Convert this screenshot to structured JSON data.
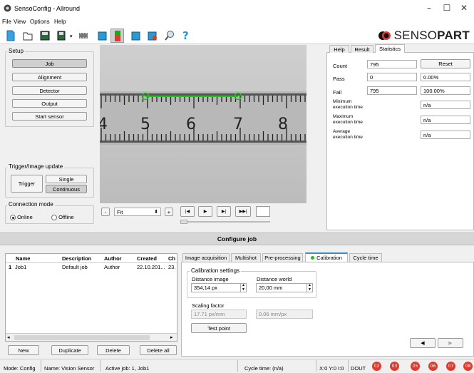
{
  "window": {
    "title": "SensoConfig - Allround",
    "minimize": "–",
    "maximize": "☐",
    "close": "✕"
  },
  "menu": [
    "File",
    "View",
    "Options",
    "Help"
  ],
  "logo": {
    "prefix": "SENSO",
    "suffix": "PART"
  },
  "setup": {
    "title": "Setup",
    "buttons": [
      "Job",
      "Alignment",
      "Detector",
      "Output",
      "Start sensor"
    ]
  },
  "trigger": {
    "title": "Trigger/Image update",
    "trigger_label": "Trigger",
    "single_label": "Single",
    "continuous_label": "Continuous"
  },
  "connection": {
    "title": "Connection mode",
    "online": "Online",
    "offline": "Offline"
  },
  "ruler": {
    "labels": [
      "4",
      "5",
      "6",
      "7",
      "8"
    ]
  },
  "image_controls": {
    "minus": "-",
    "zoom": "Fit",
    "plus": "+",
    "first": "|◀",
    "play": "▶",
    "next": "▶|",
    "last": "▶▶|"
  },
  "right_tabs": [
    "Help",
    "Result",
    "Statistics"
  ],
  "statistics": {
    "count_label": "Count",
    "count_value": "795",
    "reset_label": "Reset",
    "pass_label": "Pass",
    "pass_value": "0",
    "pass_pct": "0.00%",
    "fail_label": "Fail",
    "fail_value": "795",
    "fail_pct": "100.00%",
    "min_label": "Minimum execution time",
    "min_value": "n/a",
    "max_label": "Maximum execution time",
    "max_value": "n/a",
    "avg_label": "Average execution time",
    "avg_value": "n/a"
  },
  "configure_job": {
    "title": "Configure job"
  },
  "jobs_table": {
    "headers": [
      "Name",
      "Description",
      "Author",
      "Created",
      "Ch"
    ],
    "rows": [
      {
        "index": "1",
        "name": "Job1",
        "description": "Default job",
        "author": "Author",
        "created": "22.10.201...",
        "changed": "23."
      }
    ]
  },
  "job_buttons": [
    "New",
    "Duplicate",
    "Delete",
    "Delete all"
  ],
  "config_tabs": [
    "Image acquisition",
    "Multishot",
    "Pre-processing",
    "Calibration",
    "Cycle time"
  ],
  "calibration": {
    "settings_title": "Calibration settings",
    "distance_image_label": "Distance image",
    "distance_image_value": "354,14 px",
    "distance_world_label": "Distance world",
    "distance_world_value": "20,00 mm",
    "scaling_label": "Scaling factor",
    "scale_px_mm": "17.71 px/mm",
    "scale_mm_px": "0.06 mm/px",
    "test_point_label": "Test point",
    "nav_back": "◀",
    "nav_fwd": "▶"
  },
  "status": {
    "mode": "Mode:  Config",
    "name": "Name:  Vision Sensor",
    "active_job": "Active job:  1, Job1",
    "cycle_time": "Cycle time:  (n/a)",
    "coords": "X:0 Y:0 I:0",
    "dout": "DOUT",
    "outputs": [
      "02",
      "03",
      "05",
      "06",
      "07",
      "08"
    ]
  },
  "colors": {
    "accent_green": "#1fc11f",
    "status_red": "#e03a2e",
    "header_gray": "#d6d6d6"
  }
}
